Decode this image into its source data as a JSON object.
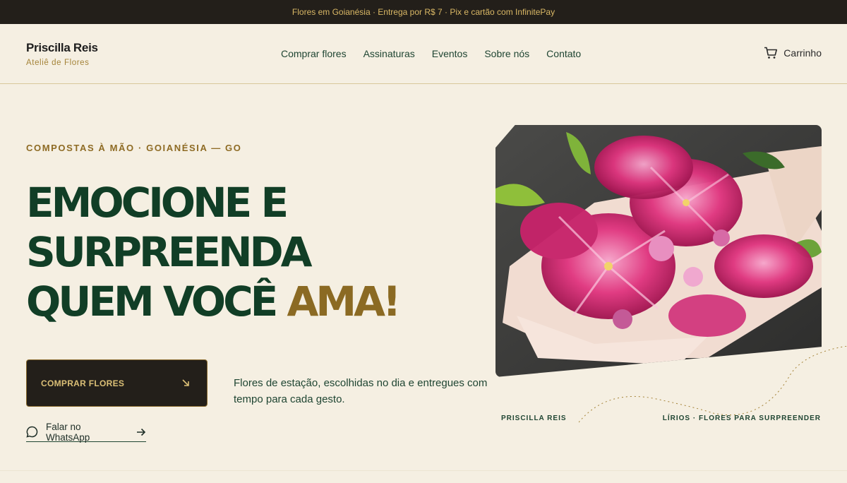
{
  "announcement": "Flores em Goianésia · Entrega por R$ 7 · Pix e cartão com InfinitePay",
  "brand": {
    "name": "Priscilla Reis",
    "subtitle": "Ateliê de Flores"
  },
  "nav": {
    "items": [
      {
        "label": "Comprar flores"
      },
      {
        "label": "Assinaturas"
      },
      {
        "label": "Eventos"
      },
      {
        "label": "Sobre nós"
      },
      {
        "label": "Contato"
      }
    ]
  },
  "cart": {
    "label": "Carrinho",
    "icon": "cart-icon"
  },
  "hero": {
    "eyebrow": "COMPOSTAS À MÃO · GOIANÉSIA — GO",
    "headline_line1": "EMOCIONE E",
    "headline_line2": "SURPREENDA",
    "headline_line3": "QUEM VOCÊ",
    "headline_accent": "AMA!",
    "cta_label": "COMPRAR FLORES",
    "cta_icon": "arrow-down-right-icon",
    "description": "Flores de estação, escolhidas no dia e entregues com tempo para cada gesto.",
    "whatsapp_label": "Falar no WhatsApp",
    "whatsapp_icon": "chat-bubble-icon",
    "whatsapp_arrow_icon": "arrow-right-icon"
  },
  "photo": {
    "caption_left": "PRISCILLA REIS",
    "caption_right": "LÍRIOS · FLORES PARA SURPREENDER"
  },
  "colors": {
    "background": "#f5efe2",
    "dark": "#231f1a",
    "green": "#113e26",
    "gold": "#8b6a23"
  }
}
